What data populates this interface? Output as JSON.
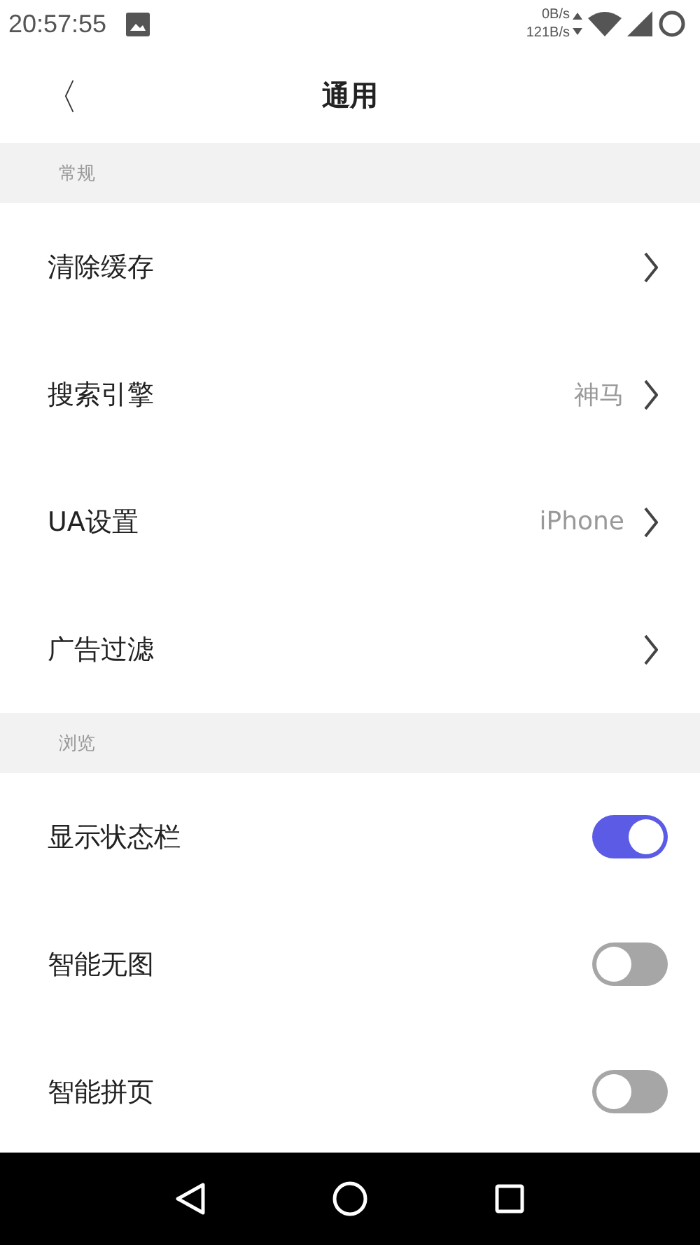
{
  "status_bar": {
    "time": "20:57:55",
    "upload_speed": "0B/s",
    "download_speed": "121B/s"
  },
  "header": {
    "back": "〈",
    "title": "通用"
  },
  "sections": [
    {
      "title": "常规",
      "rows": [
        {
          "kind": "link",
          "label": "清除缓存"
        },
        {
          "kind": "link",
          "label": "搜索引擎",
          "value": "神马"
        },
        {
          "kind": "link",
          "label": "UA设置",
          "value": "iPhone"
        },
        {
          "kind": "link",
          "label": "广告过滤"
        }
      ]
    },
    {
      "title": "浏览",
      "rows": [
        {
          "kind": "toggle",
          "label": "显示状态栏",
          "on": true
        },
        {
          "kind": "toggle",
          "label": "智能无图",
          "on": false
        },
        {
          "kind": "toggle",
          "label": "智能拼页",
          "on": false
        }
      ]
    }
  ]
}
